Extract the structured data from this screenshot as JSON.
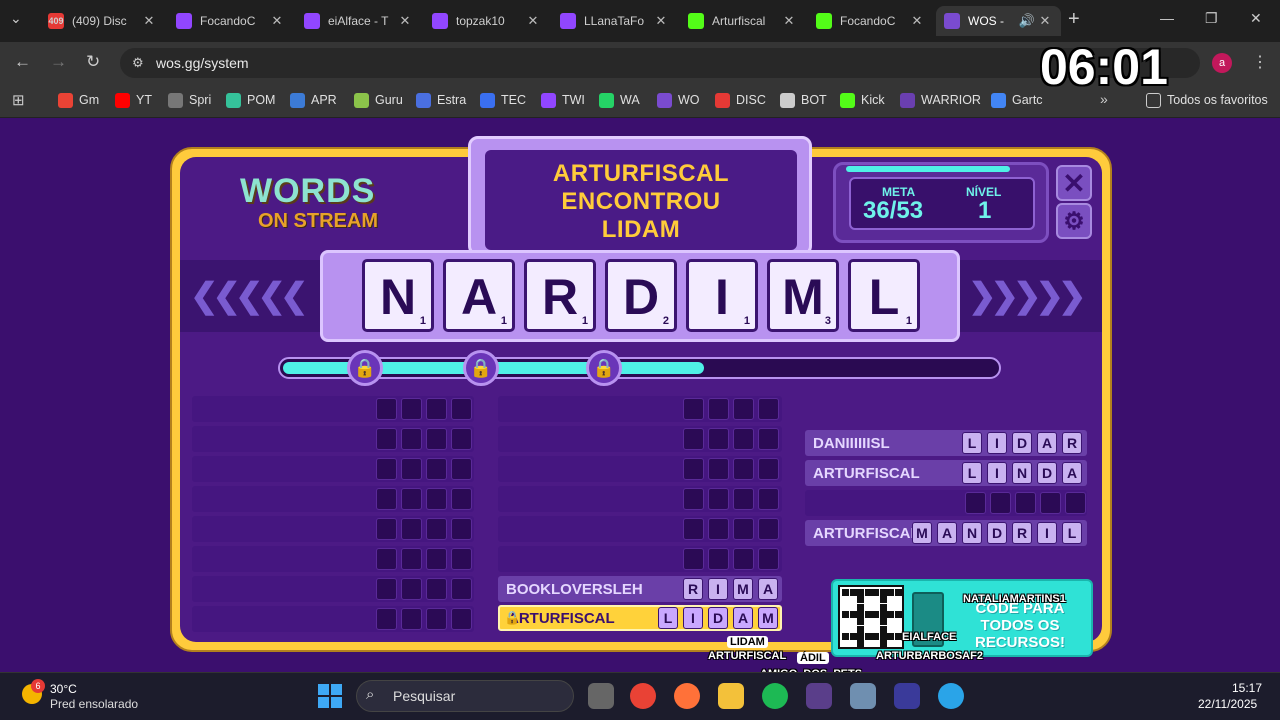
{
  "tabs": [
    {
      "title": "(409) Disc",
      "icon": "discord-icon",
      "color": "#e53935",
      "badge": "409"
    },
    {
      "title": "FocandoC",
      "icon": "twitch-icon",
      "color": "#9146ff"
    },
    {
      "title": "eiAlface - T",
      "icon": "twitch-icon",
      "color": "#9146ff"
    },
    {
      "title": "topzak10",
      "icon": "twitch-icon",
      "color": "#9146ff"
    },
    {
      "title": "LLanaTaFo",
      "icon": "twitch-icon",
      "color": "#9146ff"
    },
    {
      "title": "Arturfiscal",
      "icon": "kick-icon",
      "color": "#53fc18"
    },
    {
      "title": "FocandoC",
      "icon": "kick-icon",
      "color": "#53fc18"
    },
    {
      "title": "WOS -",
      "icon": "wos-icon",
      "color": "#7a4bd0"
    }
  ],
  "url": "wos.gg/system",
  "bookmarks": [
    {
      "label": "Gm",
      "color": "#ea4335"
    },
    {
      "label": "YT",
      "color": "#ff0000"
    },
    {
      "label": "Spri",
      "color": "#777777"
    },
    {
      "label": "POM",
      "color": "#35c29a"
    },
    {
      "label": "APR",
      "color": "#3c7bd6"
    },
    {
      "label": "Guru",
      "color": "#8bc34a"
    },
    {
      "label": "Estra",
      "color": "#4a6fe0"
    },
    {
      "label": "TEC",
      "color": "#3a6ff0"
    },
    {
      "label": "TWI",
      "color": "#9146ff"
    },
    {
      "label": "WA",
      "color": "#25d366"
    },
    {
      "label": "WO",
      "color": "#7a4bd0"
    },
    {
      "label": "DISC",
      "color": "#e53935"
    },
    {
      "label": "BOT",
      "color": "#cccccc"
    },
    {
      "label": "Kick",
      "color": "#53fc18"
    },
    {
      "label": "WARRIOR",
      "color": "#6a3fb0"
    },
    {
      "label": "Gartc",
      "color": "#4285f4"
    }
  ],
  "all_bookmarks": "Todos os favoritos",
  "profile_initial": "a",
  "overlay_clock": "06:01",
  "game": {
    "logo_line1": "WORDS",
    "logo_line2": "ON STREAM",
    "title_lines": [
      "ARTURFISCAL",
      "ENCONTROU",
      "LIDAM"
    ],
    "meta_label": "META",
    "meta_value": "36/53",
    "level_label": "NÍVEL",
    "level_value": "1",
    "tiles": [
      {
        "letter": "N",
        "points": "1"
      },
      {
        "letter": "A",
        "points": "1"
      },
      {
        "letter": "R",
        "points": "1"
      },
      {
        "letter": "D",
        "points": "2"
      },
      {
        "letter": "I",
        "points": "1"
      },
      {
        "letter": "M",
        "points": "3"
      },
      {
        "letter": "L",
        "points": "1"
      }
    ],
    "progress_fraction": 0.59,
    "found_words": [
      {
        "player": "BOOKLOVERSLEH",
        "letters": [
          "R",
          "I",
          "M",
          "A"
        ]
      },
      {
        "player": "ARTURFISCAL",
        "letters": [
          "L",
          "I",
          "D",
          "A",
          "M"
        ]
      }
    ],
    "recent_words": [
      {
        "player": "DANIIIIIISL",
        "letters": [
          "L",
          "I",
          "D",
          "A",
          "R"
        ]
      },
      {
        "player": "ARTURFISCAL",
        "letters": [
          "L",
          "I",
          "N",
          "D",
          "A"
        ]
      },
      {
        "player": "",
        "letters": []
      },
      {
        "player": "ARTURFISCAL",
        "letters": [
          "M",
          "A",
          "N",
          "D",
          "R",
          "I",
          "L"
        ]
      }
    ],
    "promo_text": "CODE PARA TODOS OS RECURSOS!",
    "overlay_names": [
      "NATALIAMARTINS1",
      "EIALFACE",
      "ARTURBARBOSAF2",
      "LIDAM",
      "ARTURFISCAL",
      "ÁDIL",
      "AMIGO_DOS_PETS"
    ]
  },
  "taskbar": {
    "temp": "30°C",
    "weather": "Pred ensolarado",
    "weather_badge": "6",
    "search": "Pesquisar",
    "time": "15:17",
    "date": "22/11/2025"
  }
}
